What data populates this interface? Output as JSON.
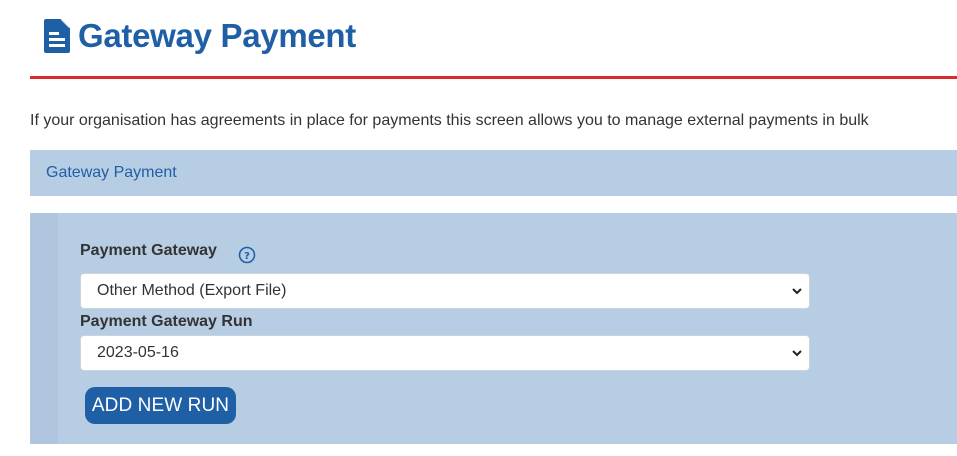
{
  "header": {
    "title": "Gateway Payment",
    "icon": "document-icon"
  },
  "intro_text": "If your organisation has agreements in place for payments this screen allows you to manage external payments in bulk",
  "panel": {
    "header_label": "Gateway Payment"
  },
  "form": {
    "gateway_label": "Payment Gateway",
    "gateway_help_icon": "help-circle-icon",
    "gateway_value": "Other Method (Export File)",
    "run_label": "Payment Gateway Run",
    "run_value": "2023-05-16",
    "add_run_label": "ADD NEW RUN"
  },
  "colors": {
    "brand_blue": "#1f5fa6",
    "accent_red": "#d92b2b",
    "panel_bg": "#b7cde3"
  }
}
